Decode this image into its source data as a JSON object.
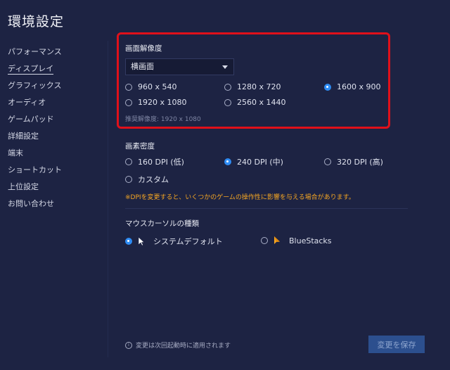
{
  "page": {
    "title": "環境設定"
  },
  "sidebar": {
    "items": [
      {
        "label": "パフォーマンス"
      },
      {
        "label": "ディスプレイ"
      },
      {
        "label": "グラフィックス"
      },
      {
        "label": "オーディオ"
      },
      {
        "label": "ゲームパッド"
      },
      {
        "label": "詳細設定"
      },
      {
        "label": "端末"
      },
      {
        "label": "ショートカット"
      },
      {
        "label": "上位設定"
      },
      {
        "label": "お問い合わせ"
      }
    ],
    "active_index": 1
  },
  "resolution": {
    "title": "画面解像度",
    "orientation": "横画面",
    "options": [
      {
        "label": "960 x 540",
        "selected": false
      },
      {
        "label": "1280 x 720",
        "selected": false
      },
      {
        "label": "1600 x 900",
        "selected": true
      },
      {
        "label": "1920 x 1080",
        "selected": false
      },
      {
        "label": "2560 x 1440",
        "selected": false
      }
    ],
    "recommended": "推奨解像度: 1920 x 1080"
  },
  "dpi": {
    "title": "画素密度",
    "options": [
      {
        "label": "160 DPI (低)",
        "selected": false
      },
      {
        "label": "240 DPI (中)",
        "selected": true
      },
      {
        "label": "320 DPI (高)",
        "selected": false
      },
      {
        "label": "カスタム",
        "selected": false
      }
    ],
    "warning": "※DPIを変更すると、いくつかのゲームの操作性に影響を与える場合があります。"
  },
  "cursor": {
    "title": "マウスカーソルの種類",
    "options": [
      {
        "label": "システムデフォルト",
        "selected": true,
        "icon": "arrow-cursor-icon"
      },
      {
        "label": "BlueStacks",
        "selected": false,
        "icon": "bluestacks-cursor-icon"
      }
    ]
  },
  "footer": {
    "note": "変更は次回起動時に適用されます",
    "save_label": "変更を保存"
  },
  "colors": {
    "background": "#1d2343",
    "accent": "#2f8cf4",
    "highlight": "#e0101a",
    "warning": "#f5a623",
    "button": "#2c4f8e"
  }
}
